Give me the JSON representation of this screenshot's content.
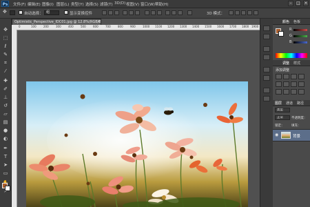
{
  "app": {
    "logo": "Ps"
  },
  "menu": [
    "文件(F)",
    "编辑(E)",
    "图像(I)",
    "图层(L)",
    "类型(Y)",
    "选择(S)",
    "滤镜(T)",
    "3D(D)",
    "视图(V)",
    "窗口(W)",
    "帮助(H)"
  ],
  "window_controls": [
    "–",
    "□",
    "×"
  ],
  "options_bar": {
    "auto_select_label": "自动选择：",
    "auto_select_value": "组",
    "show_transform_label": "显示变换控件",
    "mode_3d_label": "3D 模式："
  },
  "document": {
    "tab_title": "Optimistic_Perspective_IDC01.jpg @ 12.8%(RGB/8*)",
    "tab_close": "×",
    "ruler_numbers": [
      "0",
      "100",
      "200",
      "300",
      "400",
      "500",
      "600",
      "700",
      "800",
      "900",
      "1000",
      "1100",
      "1200",
      "1300",
      "1400",
      "1500",
      "1600",
      "1700",
      "1800",
      "1900"
    ]
  },
  "panels": {
    "color_tabs": [
      "颜色",
      "色板"
    ],
    "sliders": [
      {
        "label": "R",
        "color": "#d04a4a"
      },
      {
        "label": "G",
        "color": "#4ab04a"
      },
      {
        "label": "B",
        "color": "#4a6ad0"
      }
    ],
    "adjust_tabs": [
      "调整",
      "样式"
    ],
    "adjust_title": "添加调整",
    "layer_tabs": [
      "图层",
      "通道",
      "路径"
    ],
    "layer_kind_label": "类型",
    "blend_mode": "正常",
    "opacity_label": "不透明度：",
    "lock_label": "锁定：",
    "fill_label": "填充：",
    "layer_name": "背景"
  },
  "colors": {
    "foreground": "#a85d2e",
    "background": "#ffffff",
    "accent": "#5c6e8a"
  },
  "tools": [
    "move-tool",
    "marquee-tool",
    "lasso-tool",
    "quick-select-tool",
    "crop-tool",
    "eyedropper-tool",
    "healing-tool",
    "brush-tool",
    "clone-tool",
    "history-brush-tool",
    "eraser-tool",
    "gradient-tool",
    "blur-tool",
    "dodge-tool",
    "pen-tool",
    "type-tool",
    "path-select-tool",
    "shape-tool",
    "hand-tool",
    "zoom-tool"
  ]
}
